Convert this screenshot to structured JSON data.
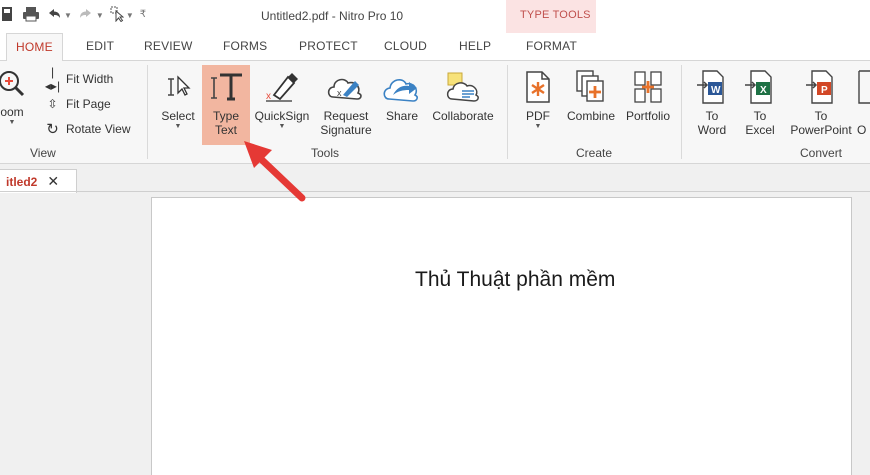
{
  "window": {
    "title": "Untitled2.pdf - Nitro Pro 10",
    "context_tab_group": "TYPE TOOLS"
  },
  "quick_access": {
    "icons": [
      "save-icon",
      "print-icon",
      "undo-icon",
      "redo-icon",
      "select-cursor-icon",
      "customize-icon"
    ]
  },
  "tabs": [
    {
      "label": "HOME",
      "active": true
    },
    {
      "label": "EDIT"
    },
    {
      "label": "REVIEW"
    },
    {
      "label": "FORMS"
    },
    {
      "label": "PROTECT"
    },
    {
      "label": "CLOUD"
    },
    {
      "label": "HELP"
    },
    {
      "label": "FORMAT"
    }
  ],
  "ribbon": {
    "view": {
      "zoom_label": "oom",
      "fit_width": "Fit Width",
      "fit_page": "Fit Page",
      "rotate_view": "Rotate View",
      "group_label": "View"
    },
    "tools": {
      "select": "Select",
      "type_text_line1": "Type",
      "type_text_line2": "Text",
      "quicksign": "QuickSign",
      "request_line1": "Request",
      "request_line2": "Signature",
      "share": "Share",
      "collaborate": "Collaborate",
      "group_label": "Tools"
    },
    "create": {
      "pdf": "PDF",
      "combine": "Combine",
      "portfolio": "Portfolio",
      "group_label": "Create"
    },
    "convert": {
      "to_word_line1": "To",
      "to_word_line2": "Word",
      "to_excel_line1": "To",
      "to_excel_line2": "Excel",
      "to_ppt_line1": "To",
      "to_ppt_line2": "PowerPoint",
      "cut_off": "O",
      "group_label": "Convert"
    }
  },
  "document_tab": {
    "label": "itled2",
    "close": "✕"
  },
  "document": {
    "text": "Thủ Thuật phần mềm"
  },
  "colors": {
    "accent": "#c0392b",
    "highlight": "#f2b6a0",
    "context": "#fbe3e3",
    "arrow": "#e53935"
  }
}
